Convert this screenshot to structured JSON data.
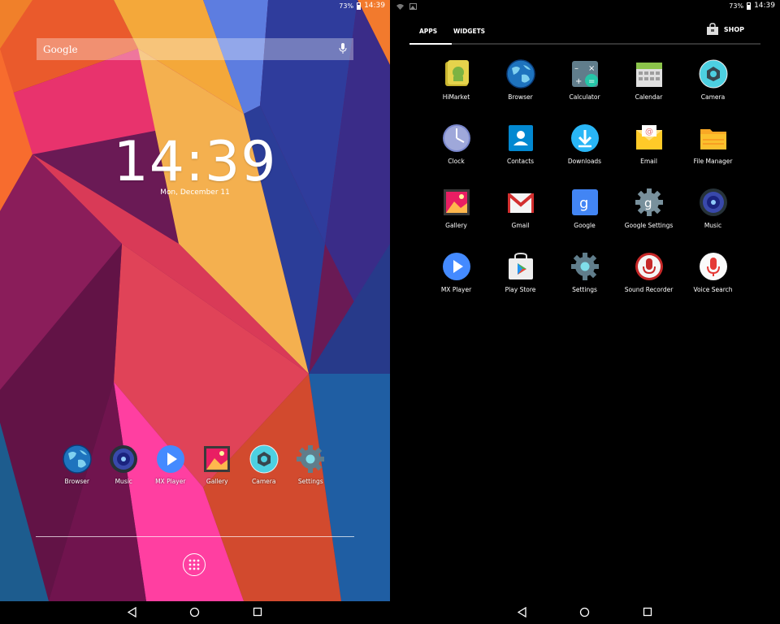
{
  "status_left": {
    "battery": "73%",
    "time": "14:39"
  },
  "status_right": {
    "battery": "73%",
    "time": "14:39"
  },
  "home": {
    "search_label": "Google",
    "clock": "14:39",
    "date": "Mon, December 11",
    "dock": [
      {
        "label": "Browser",
        "icon": "browser-globe-icon"
      },
      {
        "label": "Music",
        "icon": "music-speaker-icon"
      },
      {
        "label": "MX Player",
        "icon": "mx-player-icon"
      },
      {
        "label": "Gallery",
        "icon": "gallery-icon"
      },
      {
        "label": "Camera",
        "icon": "camera-icon"
      },
      {
        "label": "Settings",
        "icon": "settings-gear-icon"
      }
    ]
  },
  "drawer": {
    "tabs": {
      "apps": "APPS",
      "widgets": "WIDGETS"
    },
    "shop_label": "SHOP",
    "apps": [
      {
        "label": "HiMarket",
        "icon": "himarket-icon"
      },
      {
        "label": "Browser",
        "icon": "browser-globe-icon"
      },
      {
        "label": "Calculator",
        "icon": "calculator-icon"
      },
      {
        "label": "Calendar",
        "icon": "calendar-icon"
      },
      {
        "label": "Camera",
        "icon": "camera-icon"
      },
      {
        "label": "Clock",
        "icon": "clock-icon"
      },
      {
        "label": "Contacts",
        "icon": "contacts-icon"
      },
      {
        "label": "Downloads",
        "icon": "downloads-icon"
      },
      {
        "label": "Email",
        "icon": "email-icon"
      },
      {
        "label": "File Manager",
        "icon": "folder-icon"
      },
      {
        "label": "Gallery",
        "icon": "gallery-icon"
      },
      {
        "label": "Gmail",
        "icon": "gmail-icon"
      },
      {
        "label": "Google",
        "icon": "google-icon"
      },
      {
        "label": "Google Settings",
        "icon": "google-settings-icon"
      },
      {
        "label": "Music",
        "icon": "music-speaker-icon"
      },
      {
        "label": "MX Player",
        "icon": "mx-player-icon"
      },
      {
        "label": "Play Store",
        "icon": "play-store-icon"
      },
      {
        "label": "Settings",
        "icon": "settings-gear-icon"
      },
      {
        "label": "Sound Recorder",
        "icon": "sound-recorder-icon"
      },
      {
        "label": "Voice Search",
        "icon": "voice-search-icon"
      }
    ]
  },
  "colors": {
    "accent_blue": "#4285f4",
    "drawer_bg": "#000000",
    "tab_indicator": "#ffffff"
  }
}
